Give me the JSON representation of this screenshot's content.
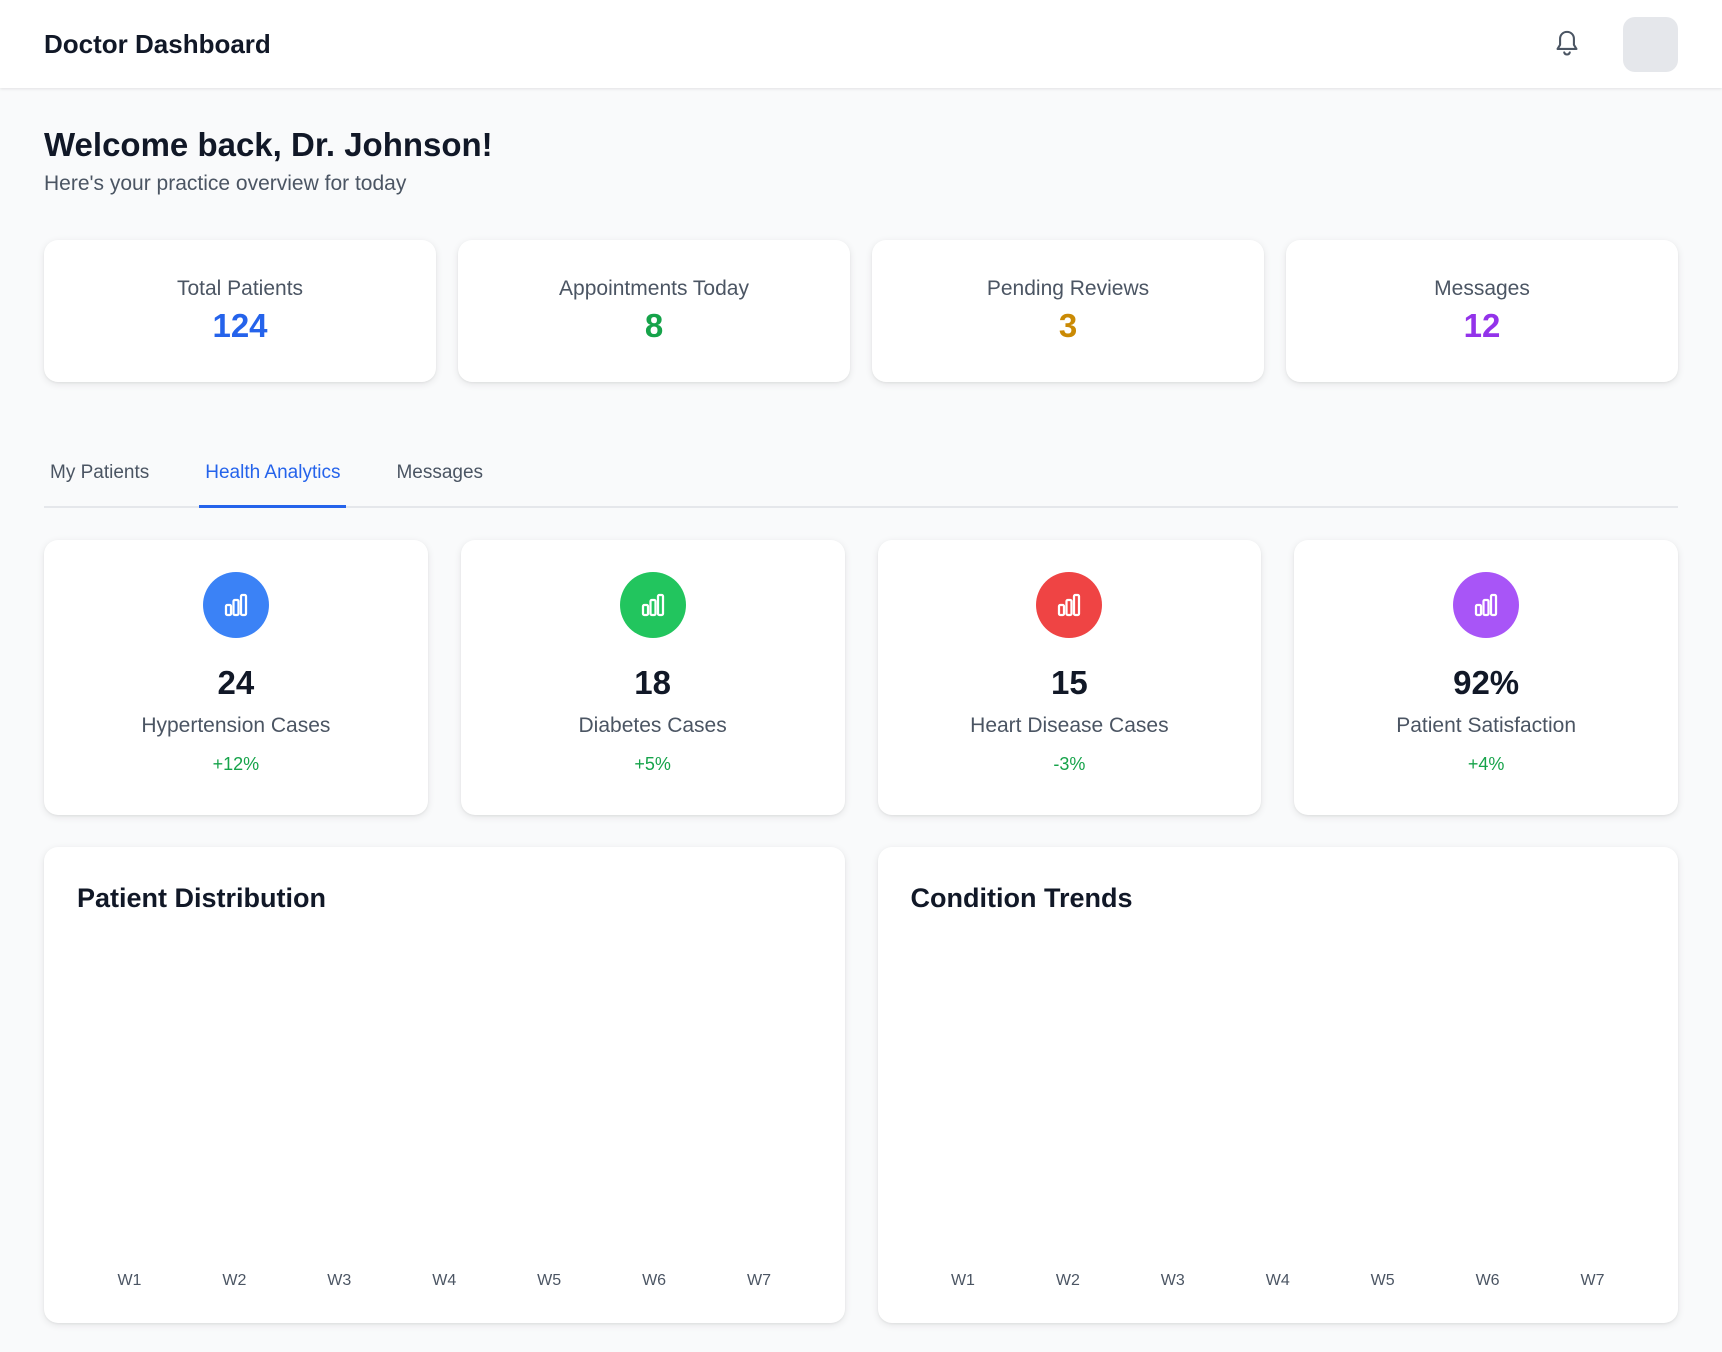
{
  "header": {
    "title": "Doctor Dashboard",
    "bell_icon": "bell-icon",
    "avatar": "avatar"
  },
  "welcome": {
    "title": "Welcome back, Dr. Johnson!",
    "subtitle": "Here's your practice overview for today"
  },
  "stats": [
    {
      "label": "Total Patients",
      "value": "124",
      "color": "#2563eb"
    },
    {
      "label": "Appointments Today",
      "value": "8",
      "color": "#16a34a"
    },
    {
      "label": "Pending Reviews",
      "value": "3",
      "color": "#ca8a04"
    },
    {
      "label": "Messages",
      "value": "12",
      "color": "#9333ea"
    }
  ],
  "tabs": [
    {
      "label": "My Patients",
      "active": false
    },
    {
      "label": "Health Analytics",
      "active": true
    },
    {
      "label": "Messages",
      "active": false
    }
  ],
  "metrics": [
    {
      "value": "24",
      "label": "Hypertension Cases",
      "change": "+12%",
      "icon": "bar-chart-icon",
      "color": "#3b82f6"
    },
    {
      "value": "18",
      "label": "Diabetes Cases",
      "change": "+5%",
      "icon": "bar-chart-icon",
      "color": "#22c55e"
    },
    {
      "value": "15",
      "label": "Heart Disease Cases",
      "change": "-3%",
      "icon": "bar-chart-icon",
      "color": "#ef4444"
    },
    {
      "value": "92%",
      "label": "Patient Satisfaction",
      "change": "+4%",
      "icon": "bar-chart-icon",
      "color": "#a855f7"
    }
  ],
  "charts": [
    {
      "title": "Patient Distribution",
      "ticks": [
        "W1",
        "W2",
        "W3",
        "W4",
        "W5",
        "W6",
        "W7"
      ]
    },
    {
      "title": "Condition Trends",
      "ticks": [
        "W1",
        "W2",
        "W3",
        "W4",
        "W5",
        "W6",
        "W7"
      ]
    }
  ]
}
